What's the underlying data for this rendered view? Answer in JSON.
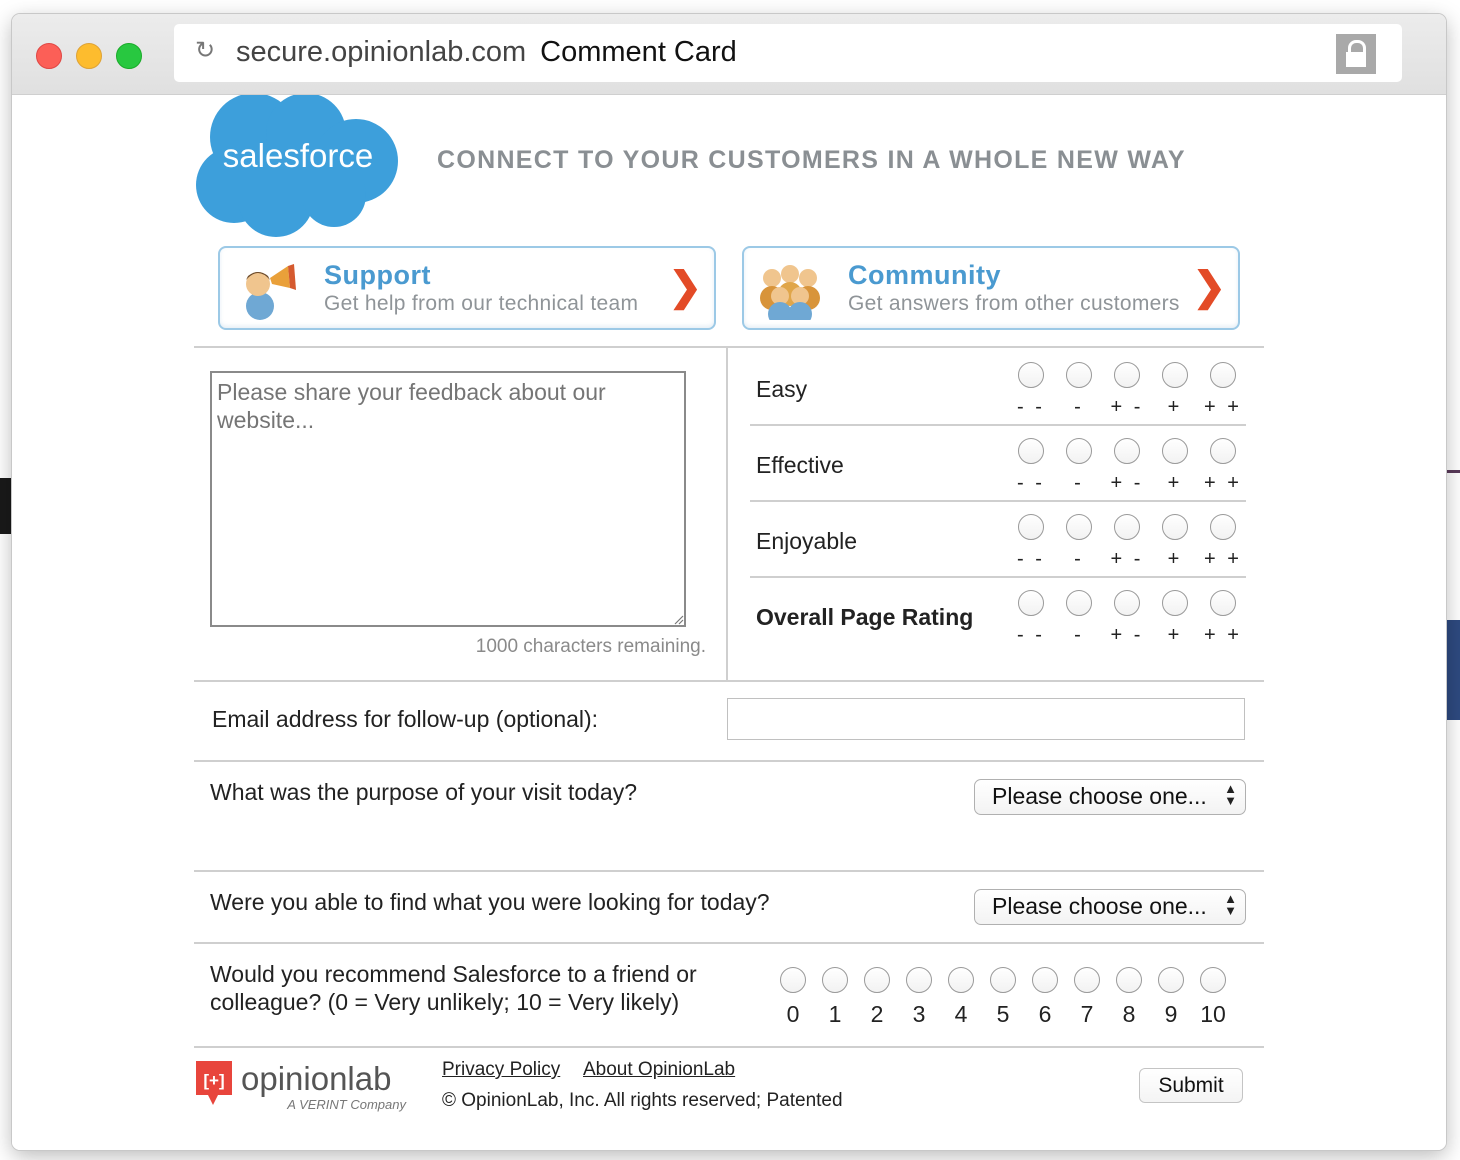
{
  "browser": {
    "domain": "secure.opinionlab.com",
    "page_title": "Comment Card"
  },
  "header": {
    "logo_text": "salesforce",
    "tagline": "CONNECT TO YOUR CUSTOMERS IN A WHOLE NEW WAY"
  },
  "nav": {
    "support": {
      "title": "Support",
      "subtitle": "Get help from our technical team",
      "chevron": "❯"
    },
    "community": {
      "title": "Community",
      "subtitle": "Get answers from other customers",
      "chevron": "❯"
    }
  },
  "feedback": {
    "placeholder": "Please share your feedback about our website...",
    "remaining": "1000 characters remaining."
  },
  "ratings": {
    "scale": [
      "- -",
      "-",
      "+ -",
      "+",
      "+ +"
    ],
    "rows": [
      {
        "label": "Easy"
      },
      {
        "label": "Effective"
      },
      {
        "label": "Enjoyable"
      },
      {
        "label": "Overall Page Rating"
      }
    ]
  },
  "email": {
    "label": "Email address for follow-up (optional):",
    "value": ""
  },
  "purpose": {
    "question": "What was the purpose of your visit today?",
    "selected": "Please choose one..."
  },
  "found": {
    "question": "Were you able to find what you were looking for today?",
    "selected": "Please choose one..."
  },
  "recommend": {
    "question_line1": "Would you recommend Salesforce to a friend or",
    "question_line2": "colleague? (0 = Very unlikely; 10 = Very likely)",
    "scale": [
      "0",
      "1",
      "2",
      "3",
      "4",
      "5",
      "6",
      "7",
      "8",
      "9",
      "10"
    ]
  },
  "footer": {
    "logo_mark": "[+]",
    "logo_text": "opinionlab",
    "logo_sub": "A VERINT Company",
    "privacy": "Privacy Policy",
    "about": "About OpinionLab",
    "copyright": "© OpinionLab, Inc. All rights reserved; Patented",
    "submit": "Submit"
  },
  "colors": {
    "salesforce_blue": "#3d9fdb",
    "nav_border": "#9cc9e6",
    "nav_title": "#4a9ad0",
    "chevron": "#e34b27",
    "opinionlab_red": "#e8453c"
  }
}
